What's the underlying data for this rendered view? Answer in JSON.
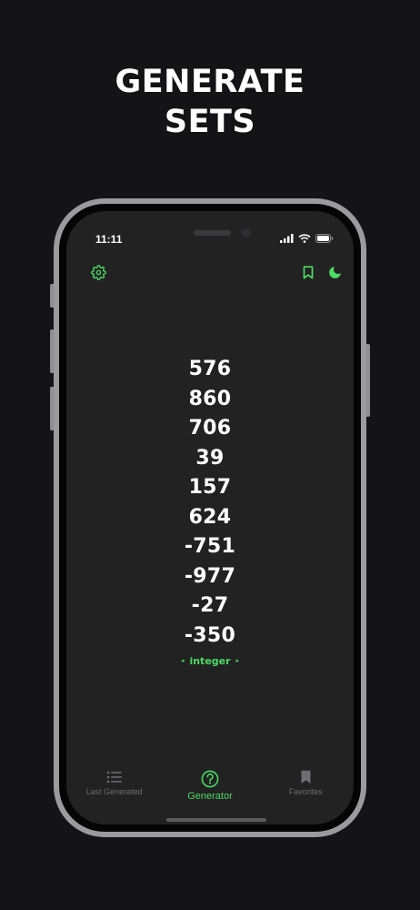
{
  "headline": {
    "line1": "GENERATE",
    "line2": "SETS"
  },
  "status_bar": {
    "time": "11:11"
  },
  "toolbar": {
    "settings_icon": "gear-icon",
    "bookmark_icon": "bookmark-icon",
    "theme_icon": "moon-icon"
  },
  "numbers": [
    "576",
    "860",
    "706",
    "39",
    "157",
    "624",
    "-751",
    "-977",
    "-27",
    "-350"
  ],
  "number_type": {
    "label": "integer",
    "prev": "◂",
    "next": "▸"
  },
  "tabs": [
    {
      "label": "Last Generated",
      "icon": "list-icon",
      "active": false
    },
    {
      "label": "Generator",
      "icon": "question-circle-icon",
      "active": true
    },
    {
      "label": "Favorites",
      "icon": "bookmark-icon",
      "active": false
    }
  ],
  "colors": {
    "accent": "#4cd964",
    "background": "#141315",
    "screen": "#222222",
    "inactive": "#6e6e73"
  }
}
